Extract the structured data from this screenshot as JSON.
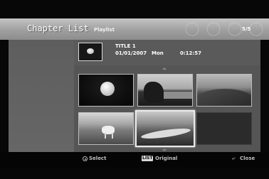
{
  "header": {
    "title": "Chapter List",
    "subtitle": "Playlist",
    "page_indicator": "5/5"
  },
  "info": {
    "title": "TITLE 1",
    "date": "01/01/2007",
    "day": "Mon",
    "time": "0:12:57"
  },
  "chapters": [
    {
      "scene": "moon-night",
      "selected": false
    },
    {
      "scene": "tree-lake",
      "selected": false
    },
    {
      "scene": "hills",
      "selected": false
    },
    {
      "scene": "horse-field",
      "selected": false
    },
    {
      "scene": "river-valley",
      "selected": true
    },
    {
      "scene": "empty",
      "selected": false
    }
  ],
  "footer": {
    "select_label": "Select",
    "list_badge": "LIST",
    "original_label": "Original",
    "close_label": "Close"
  },
  "icons": {
    "select": "select-circle-icon",
    "return": "return-icon"
  }
}
